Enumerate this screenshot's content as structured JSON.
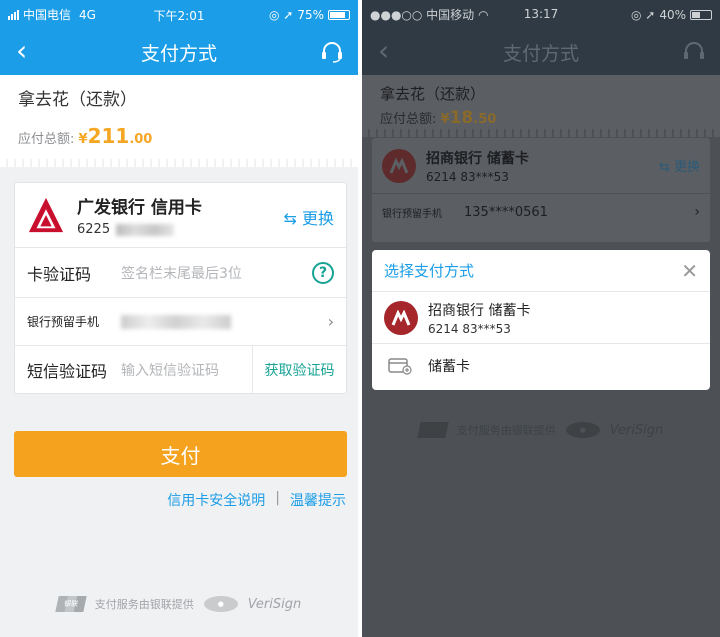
{
  "left": {
    "status": {
      "carrier": "中国电信",
      "network": "4G",
      "time": "下午2:01",
      "battery": "75%",
      "battery_level": 0.75
    },
    "nav": {
      "title": "支付方式"
    },
    "order": {
      "title": "拿去花（还款）",
      "amount_label": "应付总额:",
      "currency": "¥",
      "amount_int": "211",
      "amount_dec": ".00"
    },
    "card": {
      "bank_name": "广发银行 信用卡",
      "card_prefix": "6225",
      "change_label": "⇆ 更换",
      "cvv_label": "卡验证码",
      "cvv_placeholder": "签名栏末尾最后3位",
      "phone_label": "银行预留手机",
      "sms_label": "短信验证码",
      "sms_placeholder": "输入短信验证码",
      "get_code_label": "获取验证码"
    },
    "pay_button": "支付",
    "links": {
      "security": "信用卡安全说明",
      "sep": "|",
      "tips": "温馨提示"
    },
    "footer": {
      "text": "支付服务由银联提供",
      "unionpay": "银联",
      "verisign": "VeriSign"
    }
  },
  "right": {
    "status": {
      "carrier": "●●●○○ 中国移动",
      "time": "13:17",
      "battery": "40%",
      "battery_level": 0.4
    },
    "nav": {
      "title": "支付方式"
    },
    "order": {
      "title": "拿去花（还款）",
      "amount_label": "应付总额:",
      "currency": "¥",
      "amount_int": "18",
      "amount_dec": ".50"
    },
    "card": {
      "bank_name": "招商银行 储蓄卡",
      "card_number": "6214 83***53",
      "change_label": "⇆ 更换",
      "phone_label": "银行预留手机",
      "phone_value": "135****0561"
    },
    "modal": {
      "title": "选择支付方式",
      "options": [
        {
          "name": "招商银行 储蓄卡",
          "number": "6214 83***53"
        },
        {
          "name": "储蓄卡"
        }
      ]
    },
    "footer": {
      "text": "支付服务由银联提供",
      "verisign": "VeriSign"
    }
  },
  "colors": {
    "accent": "#1b9de7",
    "pay_button": "#f5a21f",
    "amount": "#f5a623",
    "teal": "#17a394",
    "cmb_red": "#a5262b",
    "gf_red": "#c8102e"
  }
}
